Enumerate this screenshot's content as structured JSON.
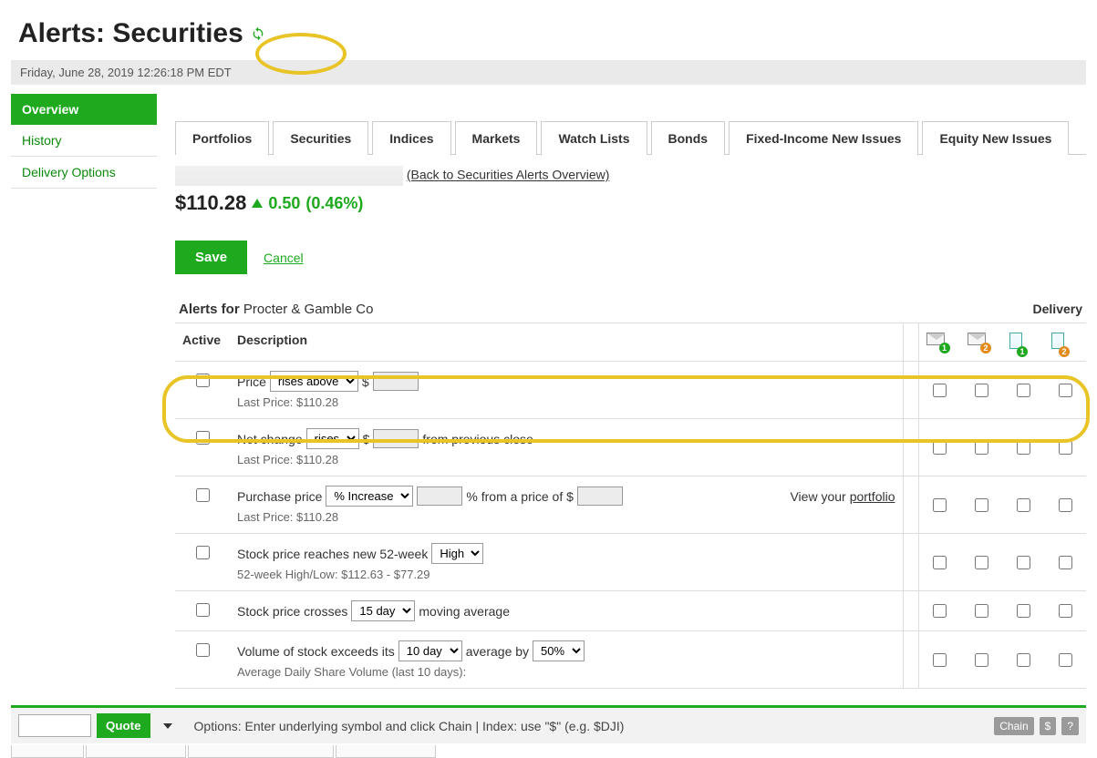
{
  "header": {
    "title": "Alerts: Securities",
    "datetime": "Friday, June 28, 2019 12:26:18 PM EDT"
  },
  "sidebar": {
    "items": [
      {
        "label": "Overview",
        "active": true
      },
      {
        "label": "History",
        "active": false
      },
      {
        "label": "Delivery Options",
        "active": false
      }
    ]
  },
  "tabs": [
    {
      "label": "Portfolios"
    },
    {
      "label": "Securities",
      "active": true
    },
    {
      "label": "Indices"
    },
    {
      "label": "Markets"
    },
    {
      "label": "Watch Lists"
    },
    {
      "label": "Bonds"
    },
    {
      "label": "Fixed-Income New Issues"
    },
    {
      "label": "Equity New Issues"
    }
  ],
  "security": {
    "back_link": "(Back to Securities Alerts Overview)",
    "price": "$110.28",
    "change_value": "0.50",
    "change_pct": "(0.46%)",
    "direction": "up"
  },
  "actions": {
    "save_label": "Save",
    "cancel_label": "Cancel"
  },
  "alerts_header": {
    "prefix": "Alerts for ",
    "company": "Procter & Gamble Co",
    "delivery_label": "Delivery"
  },
  "columns": {
    "active": "Active",
    "description": "Description"
  },
  "delivery_icons": [
    {
      "name": "mail-icon-1",
      "type": "mail",
      "badge": "1",
      "color": "g"
    },
    {
      "name": "mail-icon-2",
      "type": "mail",
      "badge": "2",
      "color": "o"
    },
    {
      "name": "doc-icon-1",
      "type": "doc",
      "badge": "1",
      "color": "g"
    },
    {
      "name": "doc-icon-2",
      "type": "doc",
      "badge": "2",
      "color": "o"
    }
  ],
  "rows": [
    {
      "pre": "Price ",
      "select_options": [
        "rises above"
      ],
      "post": " $ ",
      "input": true,
      "sub": "Last Price: $110.28"
    },
    {
      "pre": "Net change ",
      "select_options": [
        "rises"
      ],
      "post": " $ ",
      "input": true,
      "tail": " from previous close",
      "sub": "Last Price: $110.28"
    },
    {
      "pre": "Purchase price ",
      "select_options": [
        "% Increase"
      ],
      "input": true,
      "post_input": " %  from a price of $ ",
      "input2": true,
      "right_text": "View your ",
      "right_link": "portfolio",
      "sub": "Last Price: $110.28"
    },
    {
      "pre": "Stock price reaches new 52-week ",
      "select_options": [
        "High"
      ],
      "sub": "52-week High/Low: $112.63 - $77.29"
    },
    {
      "pre": "Stock price crosses ",
      "select_options": [
        "15 day"
      ],
      "tail": " moving average"
    },
    {
      "pre": "Volume of stock exceeds its ",
      "select_options": [
        "10 day"
      ],
      "mid": " average by ",
      "select2_options": [
        "50%"
      ],
      "sub": "Average Daily Share Volume (last 10 days):"
    }
  ],
  "bottom": {
    "quote_label": "Quote",
    "hint": "Options: Enter underlying symbol and click Chain | Index: use \"$\" (e.g. $DJI)",
    "chips": [
      "Chain",
      "$",
      "?"
    ]
  }
}
